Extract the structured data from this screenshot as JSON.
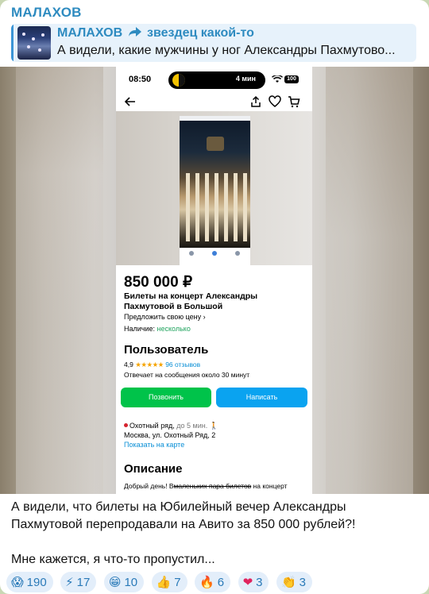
{
  "channel": {
    "name": "МАЛАХОВ"
  },
  "reply": {
    "title_left": "МАЛАХОВ",
    "title_right": "звездец какой-то",
    "text": "А видели, какие мужчины у ног Александры Пахмутово..."
  },
  "phone": {
    "time": "08:50",
    "island_text": "4 мин",
    "battery": "100",
    "listing": {
      "price": "850 000 ₽",
      "title": "Билеты на концерт Александры Пахмутовой в Большой",
      "offer": "Предложить свою цену",
      "stock_label": "Наличие:",
      "stock_value": "несколько",
      "seller": "Пользователь",
      "rating": "4,9",
      "stars": "★★★★★",
      "reviews": "96 отзывов",
      "responds": "Отвечает на сообщения около 30 минут",
      "call_button": "Позвонить",
      "write_button": "Написать",
      "metro": "Охотный ряд,",
      "metro_time": "до 5 мин.",
      "address": "Москва, ул. Охотный Ряд, 2",
      "map_link": "Показать на карте",
      "desc_title": "Описание",
      "desc_start": "Добрый день! В",
      "desc_struck": "маленьких пара билетов",
      "desc_end": " на концерт"
    }
  },
  "caption": {
    "line1": "А видели, что билеты на Юбилейный вечер Александры Пахмутовой перепродавали на Авито за 850 000 рублей?!",
    "line2": "Мне кажется, я что-то пропустил..."
  },
  "reactions": [
    {
      "emoji": "😱",
      "count": "190"
    },
    {
      "emoji": "⚡",
      "count": "17"
    },
    {
      "emoji": "😁",
      "count": "10"
    },
    {
      "emoji": "👍",
      "count": "7"
    },
    {
      "emoji": "🔥",
      "count": "6"
    },
    {
      "emoji": "❤",
      "count": "3"
    },
    {
      "emoji": "👏",
      "count": "3"
    }
  ],
  "colors": {
    "accent": "#2e8bc0",
    "call": "#00c34a",
    "write": "#0aa3f0",
    "link": "#0a8fd6"
  }
}
